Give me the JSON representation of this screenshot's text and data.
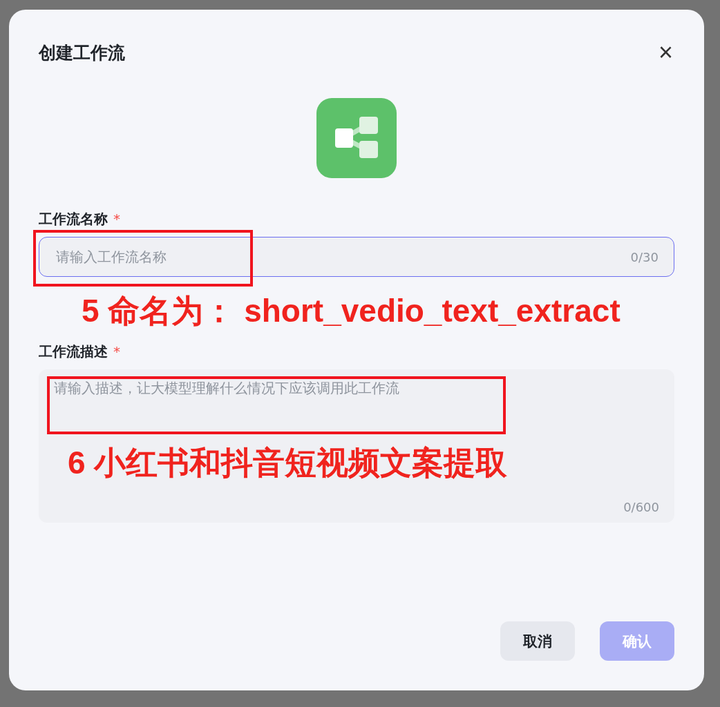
{
  "dialog": {
    "title": "创建工作流",
    "close": "×"
  },
  "name_field": {
    "label": "工作流名称",
    "required_mark": "*",
    "placeholder": "请输入工作流名称",
    "counter": "0/30",
    "focused": true,
    "annotation": "5 命名为： short_vedio_text_extract"
  },
  "description_field": {
    "label": "工作流描述",
    "required_mark": "*",
    "placeholder": "请输入描述，让大模型理解什么情况下应该调用此工作流",
    "counter": "0/600",
    "annotation": "6 小红书和抖音短视频文案提取"
  },
  "buttons": [
    {
      "label": "取消",
      "kind": "secondary"
    },
    {
      "label": "确认",
      "kind": "primary",
      "disabled": true
    }
  ]
}
